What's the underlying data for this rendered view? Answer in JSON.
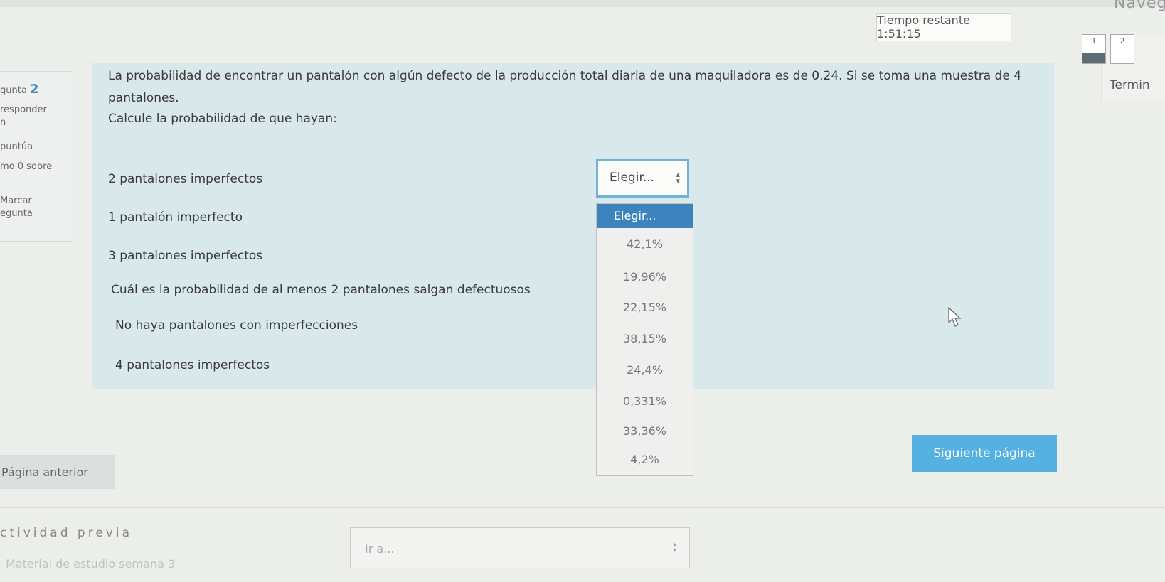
{
  "header": {
    "nav_title": "Naveg",
    "timer": "Tiempo restante 1:51:15",
    "nav_buttons": [
      "1",
      "2"
    ],
    "finish_link": "Termin"
  },
  "question_info": {
    "number_label": "gunta",
    "number": "2",
    "status": "responder",
    "status_line": "n",
    "score_line": "puntúa",
    "score_max": "mo 0 sobre",
    "flag_line1": "Marcar",
    "flag_line2": "egunta"
  },
  "question": {
    "text": "La probabilidad de encontrar un pantalón con algún defecto de la producción total diaria de una maquiladora es de 0.24. Si se toma una muestra de 4 pantalones.",
    "subtext": "Calcule la probabilidad de que hayan:",
    "items": [
      "2 pantalones imperfectos",
      "1 pantalón imperfecto",
      "3 pantalones imperfectos",
      "Cuál es la probabilidad de al menos 2 pantalones salgan defectuosos",
      "No haya pantalones con imperfecciones",
      "4 pantalones imperfectos"
    ]
  },
  "select": {
    "value": "Elegir...",
    "options": [
      "Elegir...",
      "42,1%",
      "19,96%",
      "22,15%",
      "38,15%",
      "24,4%",
      "0,331%",
      "33,36%",
      "4,2%"
    ]
  },
  "footer": {
    "prev_button": "Página anterior",
    "next_button": "Siguiente página",
    "prev_activity": "ctividad previa",
    "material_link": "Material de estudio semana 3",
    "jump_placeholder": "Ir a..."
  }
}
